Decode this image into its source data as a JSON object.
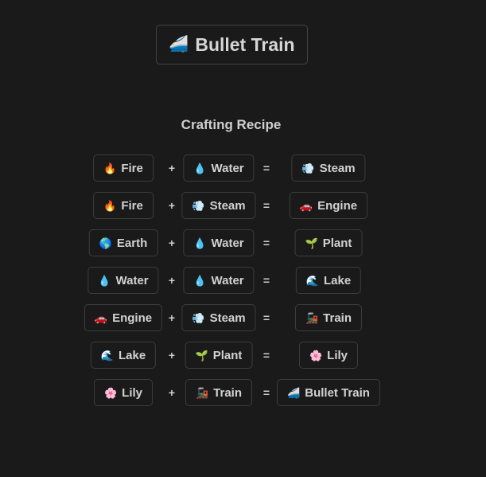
{
  "title": {
    "icon": "bullet-train-icon",
    "emoji": "🚄",
    "label": "Bullet Train"
  },
  "recipe_heading": "Crafting Recipe",
  "operators": {
    "plus": "+",
    "equals": "="
  },
  "recipes": [
    {
      "a": {
        "emoji": "🔥",
        "icon": "fire-icon",
        "label": "Fire"
      },
      "b": {
        "emoji": "💧",
        "icon": "water-drop-icon",
        "label": "Water"
      },
      "result": {
        "emoji": "💨",
        "icon": "steam-icon",
        "label": "Steam"
      }
    },
    {
      "a": {
        "emoji": "🔥",
        "icon": "fire-icon",
        "label": "Fire"
      },
      "b": {
        "emoji": "💨",
        "icon": "steam-icon",
        "label": "Steam"
      },
      "result": {
        "emoji": "🚗",
        "icon": "car-icon",
        "label": "Engine"
      }
    },
    {
      "a": {
        "emoji": "🌎",
        "icon": "globe-icon",
        "label": "Earth"
      },
      "b": {
        "emoji": "💧",
        "icon": "water-drop-icon",
        "label": "Water"
      },
      "result": {
        "emoji": "🌱",
        "icon": "seedling-icon",
        "label": "Plant"
      }
    },
    {
      "a": {
        "emoji": "💧",
        "icon": "water-drop-icon",
        "label": "Water"
      },
      "b": {
        "emoji": "💧",
        "icon": "water-drop-icon",
        "label": "Water"
      },
      "result": {
        "emoji": "🌊",
        "icon": "wave-icon",
        "label": "Lake"
      }
    },
    {
      "a": {
        "emoji": "🚗",
        "icon": "car-icon",
        "label": "Engine"
      },
      "b": {
        "emoji": "💨",
        "icon": "steam-icon",
        "label": "Steam"
      },
      "result": {
        "emoji": "🚂",
        "icon": "locomotive-icon",
        "label": "Train"
      }
    },
    {
      "a": {
        "emoji": "🌊",
        "icon": "wave-icon",
        "label": "Lake"
      },
      "b": {
        "emoji": "🌱",
        "icon": "seedling-icon",
        "label": "Plant"
      },
      "result": {
        "emoji": "🌸",
        "icon": "cherry-blossom-icon",
        "label": "Lily"
      }
    },
    {
      "a": {
        "emoji": "🌸",
        "icon": "cherry-blossom-icon",
        "label": "Lily"
      },
      "b": {
        "emoji": "🚂",
        "icon": "locomotive-icon",
        "label": "Train"
      },
      "result": {
        "emoji": "🚄",
        "icon": "bullet-train-icon",
        "label": "Bullet Train"
      }
    }
  ]
}
